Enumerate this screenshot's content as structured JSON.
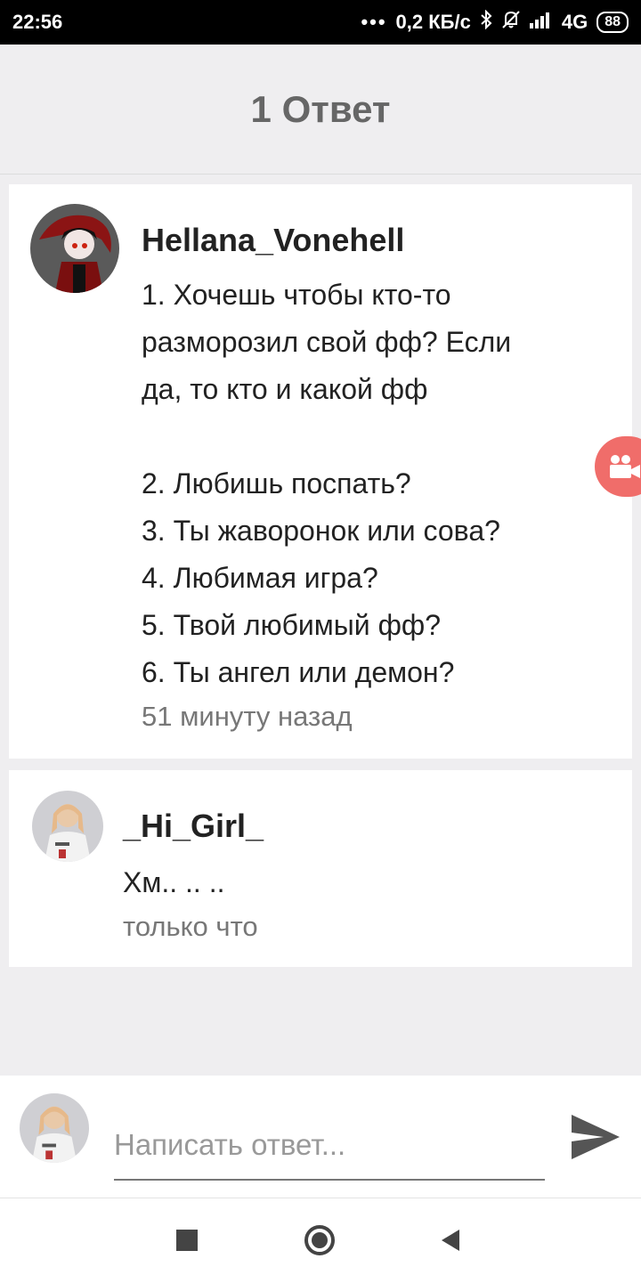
{
  "status_bar": {
    "time": "22:56",
    "dots": "•••",
    "speed": "0,2 КБ/с",
    "bluetooth_icon": "bluetooth-icon",
    "bell_icon": "bell-off-icon",
    "signal": "4G",
    "battery": "88"
  },
  "header": {
    "title": "1 Ответ"
  },
  "comments": [
    {
      "author": "Hellana_Vonehell",
      "text": "1. Хочешь чтобы кто-то\nразморозил свой фф? Если\nда, то кто и какой фф\n\n2. Любишь поспать?\n3. Ты жаворонок или сова?\n4. Любимая игра?\n5. Твой любимый фф?\n6. Ты ангел или демон?",
      "time": "51 минуту назад"
    },
    {
      "author": "_Hi_Girl_",
      "text": "Хм.. .. ..",
      "time": "только что"
    }
  ],
  "reply": {
    "placeholder": "Написать ответ...",
    "value": ""
  },
  "colors": {
    "fab": "#f06d6a",
    "header_text": "#666666",
    "background": "#efeef0"
  },
  "icons": {
    "fab": "video-camera-icon",
    "send": "send-icon",
    "nav": [
      "recent-apps-icon",
      "home-icon",
      "back-icon"
    ]
  }
}
